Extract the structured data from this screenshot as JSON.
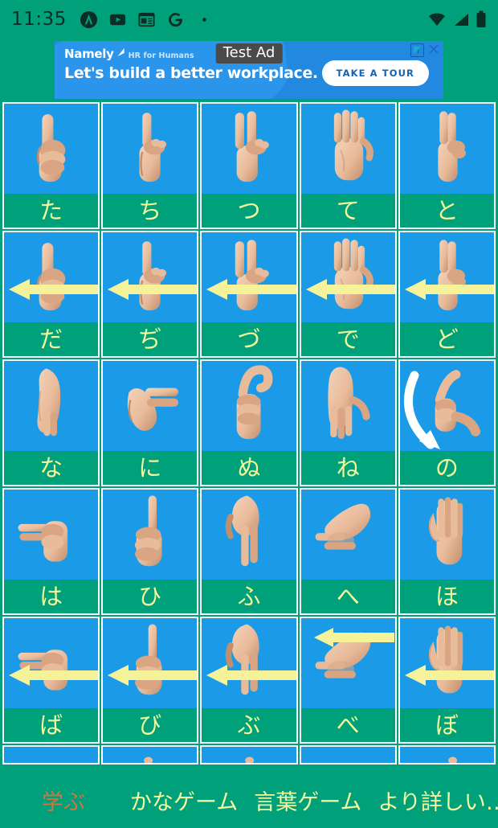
{
  "status_bar": {
    "time": "11:35",
    "left_icons": [
      "circled-a-icon",
      "youtube-icon",
      "news-calendar-icon",
      "google-g-icon",
      "dot-icon"
    ],
    "right_icons": [
      "wifi-icon",
      "cellular-signal-icon",
      "battery-icon"
    ]
  },
  "ad": {
    "test_badge": "Test Ad",
    "brand": "Namely",
    "tagline": "HR for Humans",
    "headline": "Let's build a better workplace.",
    "cta": "TAKE A TOUR",
    "adchoices_icon": "adchoices-icon",
    "close_icon": "close-icon",
    "bg_color": "#2388e0",
    "cta_text_color": "#1463b0"
  },
  "grid": {
    "cell_bg": "#1b9ae8",
    "label_bg": "#00a07a",
    "label_color": "#f2f79a",
    "border_color": "#ffffff",
    "arrow_color": "#f5f29a",
    "curve_arrow_color": "#ffffff",
    "rows": [
      {
        "cells": [
          {
            "kana": "た",
            "sign": "thumb-up-hand",
            "arrow": "none"
          },
          {
            "kana": "ち",
            "sign": "index-up-hand",
            "arrow": "none"
          },
          {
            "kana": "つ",
            "sign": "two-fingers-up-hand",
            "arrow": "none"
          },
          {
            "kana": "て",
            "sign": "open-palm-hand",
            "arrow": "none"
          },
          {
            "kana": "と",
            "sign": "two-fingers-together-hand",
            "arrow": "none"
          }
        ]
      },
      {
        "cells": [
          {
            "kana": "だ",
            "sign": "thumb-up-hand",
            "arrow": "left"
          },
          {
            "kana": "ぢ",
            "sign": "index-up-hand",
            "arrow": "left"
          },
          {
            "kana": "づ",
            "sign": "two-fingers-up-hand",
            "arrow": "left"
          },
          {
            "kana": "で",
            "sign": "open-palm-hand",
            "arrow": "left"
          },
          {
            "kana": "ど",
            "sign": "two-fingers-together-hand",
            "arrow": "left"
          }
        ]
      },
      {
        "cells": [
          {
            "kana": "な",
            "sign": "hand-pointing-down",
            "arrow": "none"
          },
          {
            "kana": "に",
            "sign": "two-fingers-sideways-hand",
            "arrow": "none"
          },
          {
            "kana": "ぬ",
            "sign": "bent-finger-fist-hand",
            "arrow": "none"
          },
          {
            "kana": "ね",
            "sign": "flat-hand-down",
            "arrow": "none"
          },
          {
            "kana": "の",
            "sign": "index-point-hand",
            "arrow": "curve"
          }
        ]
      },
      {
        "cells": [
          {
            "kana": "は",
            "sign": "two-fingers-forward-hand",
            "arrow": "none"
          },
          {
            "kana": "ひ",
            "sign": "index-up-fist-hand",
            "arrow": "none"
          },
          {
            "kana": "ふ",
            "sign": "two-fingers-down-hand",
            "arrow": "none"
          },
          {
            "kana": "へ",
            "sign": "pointing-finger-side-hand",
            "arrow": "none"
          },
          {
            "kana": "ほ",
            "sign": "flat-vertical-palm-hand",
            "arrow": "none"
          }
        ]
      },
      {
        "cells": [
          {
            "kana": "ば",
            "sign": "two-fingers-forward-hand",
            "arrow": "left"
          },
          {
            "kana": "び",
            "sign": "index-up-fist-hand",
            "arrow": "left"
          },
          {
            "kana": "ぶ",
            "sign": "two-fingers-down-hand",
            "arrow": "left"
          },
          {
            "kana": "べ",
            "sign": "pointing-finger-side-hand",
            "arrow": "top"
          },
          {
            "kana": "ぼ",
            "sign": "flat-vertical-palm-hand",
            "arrow": "left"
          }
        ]
      }
    ],
    "partial_row_cells": 5
  },
  "bottom_nav": {
    "selected_color": "#d2743f",
    "item_color": "#f3f8a0",
    "items": [
      {
        "label": "学ぶ",
        "selected": true
      },
      {
        "label": "かなゲーム",
        "selected": false
      },
      {
        "label": "言葉ゲーム",
        "selected": false
      },
      {
        "label": "より詳しい…",
        "selected": false
      }
    ]
  }
}
